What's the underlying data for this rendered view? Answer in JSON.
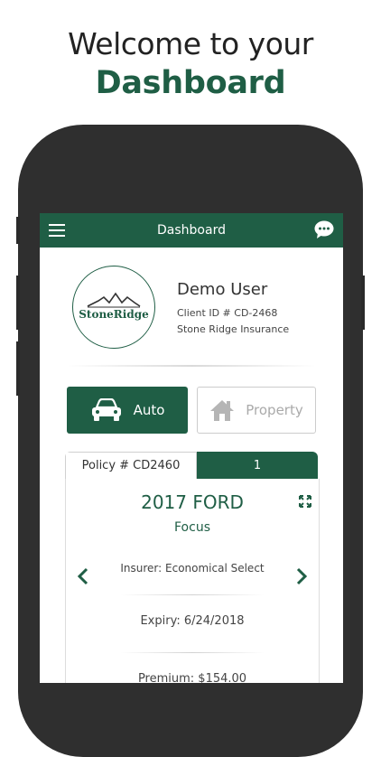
{
  "headline": {
    "line1": "Welcome to your",
    "line2": "Dashboard"
  },
  "appbar": {
    "title": "Dashboard"
  },
  "profile": {
    "logo_text": "StoneRidge",
    "name": "Demo User",
    "client_id": "Client ID # CD-2468",
    "company": "Stone Ridge Insurance"
  },
  "tabs": {
    "auto": "Auto",
    "property": "Property"
  },
  "policy": {
    "number": "Policy # CD2460",
    "count": "1",
    "year_make": "2017 FORD",
    "model": "Focus",
    "insurer": "Insurer: Economical Select",
    "expiry": "Expiry: 6/24/2018",
    "premium": "Premium: $154.00"
  },
  "colors": {
    "accent": "#1f5e45",
    "phone": "#2f2f2f"
  },
  "icons": [
    "menu-icon",
    "chat-icon",
    "car-icon",
    "house-icon",
    "expand-icon",
    "chevron-left-icon",
    "chevron-right-icon"
  ]
}
